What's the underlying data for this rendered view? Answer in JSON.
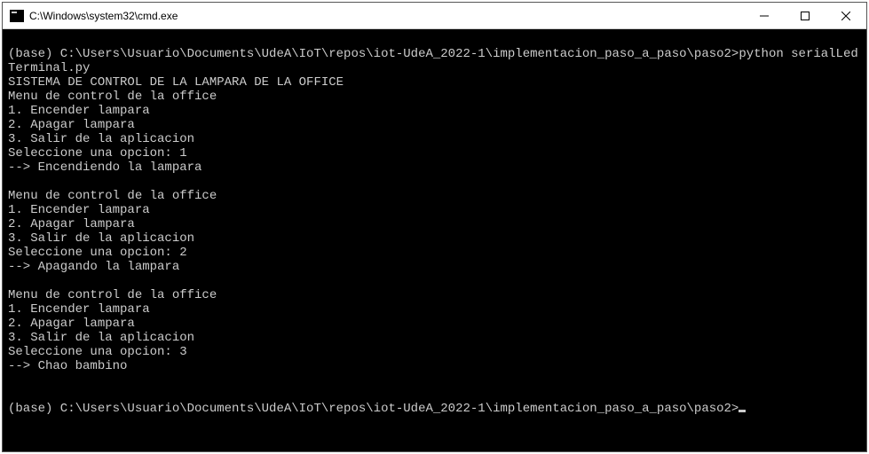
{
  "titlebar": {
    "title": "C:\\Windows\\system32\\cmd.exe"
  },
  "terminal": {
    "prompt1_prefix": "(base) C:\\Users\\Usuario\\Documents\\UdeA\\IoT\\repos\\iot-UdeA_2022-1\\implementacion_paso_a_paso\\paso2>",
    "cmd1": "python serialLedTerminal.py",
    "header": "SISTEMA DE CONTROL DE LA LAMPARA DE LA OFFICE",
    "menu_title": "Menu de control de la office",
    "opt1": "1. Encender lampara",
    "opt2": "2. Apagar lampara",
    "opt3": "3. Salir de la aplicacion",
    "select_prefix": "Seleccione una opcion: ",
    "sel1": "1",
    "resp1": "--> Encendiendo la lampara",
    "sel2": "2",
    "resp2": "--> Apagando la lampara",
    "sel3": "3",
    "resp3": "--> Chao bambino",
    "prompt2": "(base) C:\\Users\\Usuario\\Documents\\UdeA\\IoT\\repos\\iot-UdeA_2022-1\\implementacion_paso_a_paso\\paso2>"
  }
}
